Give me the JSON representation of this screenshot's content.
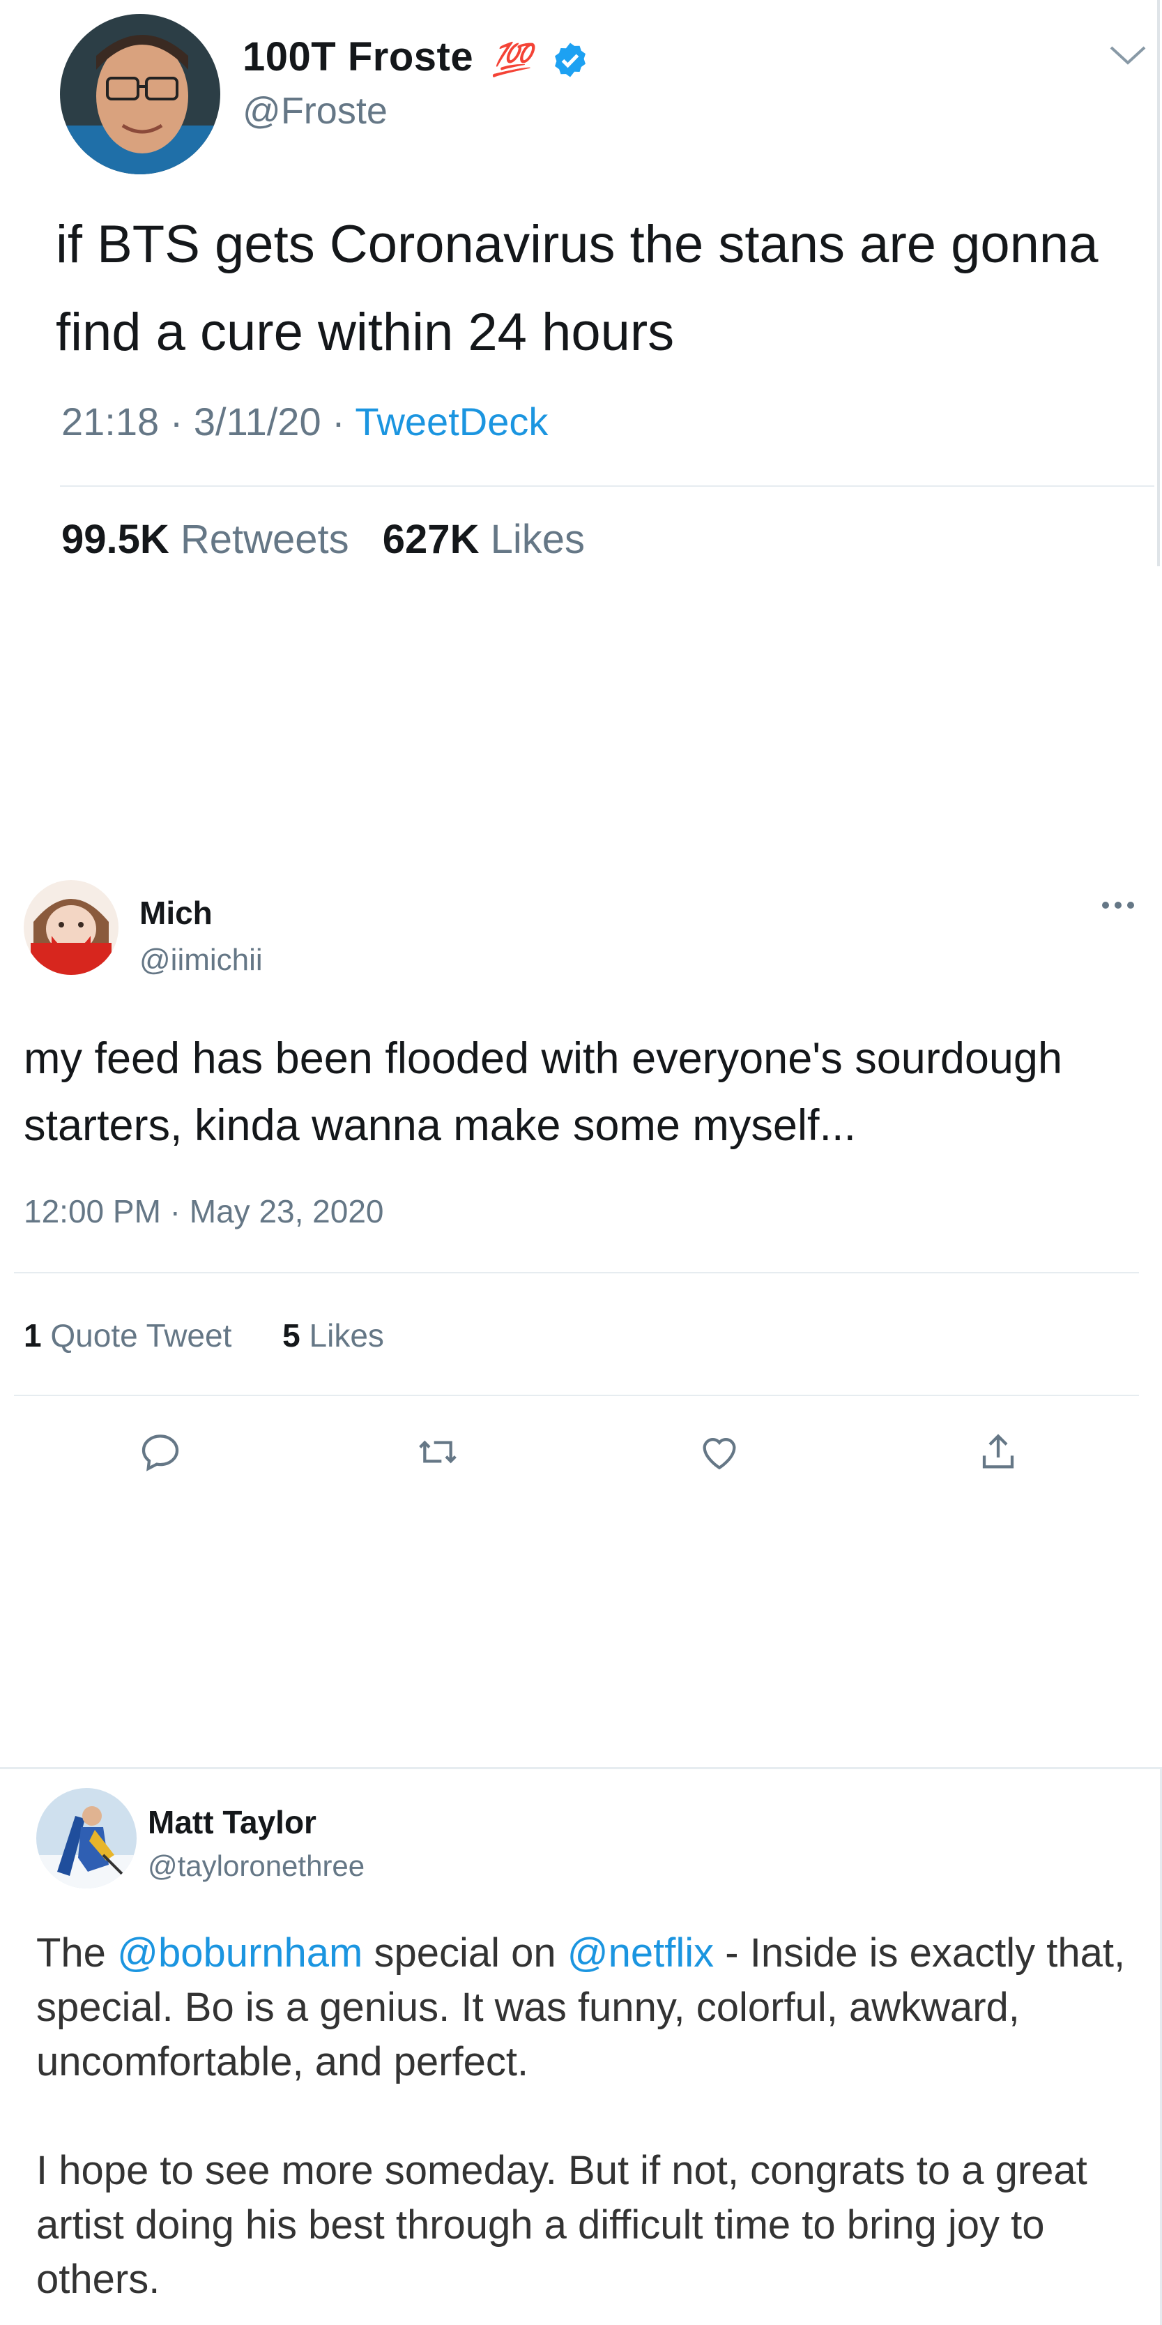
{
  "tweets": [
    {
      "author": {
        "name": "100T Froste",
        "emoji": "💯",
        "handle": "@Froste"
      },
      "text": "if BTS gets Coronavirus the stans are gonna find a cure within 24 hours",
      "time": "21:18 · 3/11/20 · ",
      "source": "TweetDeck",
      "retweets_count": "99.5K",
      "retweets_label": " Retweets",
      "likes_count": "627K",
      "likes_label": " Likes",
      "icons": [
        "verified-badge-icon",
        "chevron-down-icon"
      ]
    },
    {
      "author": {
        "name": "Mich",
        "handle": "@iimichii"
      },
      "text": "my feed has been flooded with everyone's sourdough starters, kinda wanna make some myself...",
      "time": "12:00 PM · May 23, 2020",
      "quote_count": "1",
      "quote_label": " Quote Tweet",
      "likes_count": "5",
      "likes_label": " Likes",
      "icons": [
        "more-options-icon",
        "reply-icon",
        "retweet-icon",
        "like-icon",
        "share-icon"
      ]
    },
    {
      "author": {
        "name": "Matt Taylor",
        "handle": "@tayloronethree"
      },
      "text_part1": "The ",
      "mention1": "@boburnham",
      "text_part2": " special on ",
      "mention2": "@netflix",
      "text_part3": " - Inside is exactly that, special. Bo is a genius.  It was funny, colorful, awkward, uncomfortable, and perfect.",
      "text_paragraph2": "I hope to see more someday. But if not, congrats to a great artist doing his best through a difficult time to bring joy to others."
    }
  ],
  "colors": {
    "link": "#1b95e0",
    "muted": "#657786",
    "text": "#14171a",
    "divider": "#e6ecf0"
  }
}
